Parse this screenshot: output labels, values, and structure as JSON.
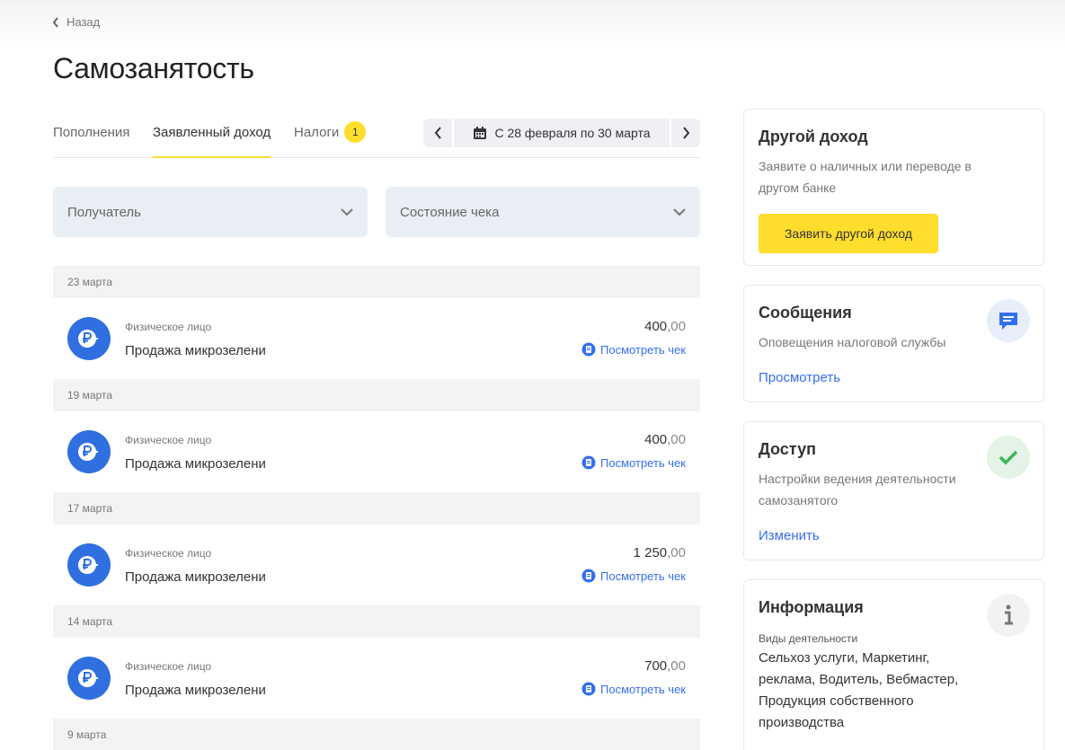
{
  "nav": {
    "back_label": "Назад"
  },
  "page": {
    "title": "Самозанятость"
  },
  "tabs": [
    {
      "label": "Пополнения",
      "active": false
    },
    {
      "label": "Заявленный доход",
      "active": true
    },
    {
      "label": "Налоги",
      "active": false,
      "badge": "1"
    }
  ],
  "period": {
    "label": "С 28 февраля по 30 марта"
  },
  "filters": {
    "recipient": "Получатель",
    "receipt_state": "Состояние чека"
  },
  "operations": [
    {
      "date": "23 марта",
      "counterparty": "Физическое лицо",
      "title": "Продажа микрозелени",
      "amount_int": "400",
      "amount_dec": ",00",
      "check_label": "Посмотреть чек"
    },
    {
      "date": "19 марта",
      "counterparty": "Физическое лицо",
      "title": "Продажа микрозелени",
      "amount_int": "400",
      "amount_dec": ",00",
      "check_label": "Посмотреть чек"
    },
    {
      "date": "17 марта",
      "counterparty": "Физическое лицо",
      "title": "Продажа микрозелени",
      "amount_int": "1 250",
      "amount_dec": ",00",
      "check_label": "Посмотреть чек"
    },
    {
      "date": "14 марта",
      "counterparty": "Физическое лицо",
      "title": "Продажа микрозелени",
      "amount_int": "700",
      "amount_dec": ",00",
      "check_label": "Посмотреть чек"
    }
  ],
  "last_date_header": "9 марта",
  "cards": {
    "other_income": {
      "title": "Другой доход",
      "text": "Заявите о наличных или переводе в другом банке",
      "button": "Заявить другой доход"
    },
    "messages": {
      "title": "Сообщения",
      "text": "Оповещения налоговой службы",
      "link": "Просмотреть",
      "icon": "message-icon"
    },
    "access": {
      "title": "Доступ",
      "text": "Настройки ведения деятельности самозанятого",
      "link": "Изменить",
      "icon": "check-icon"
    },
    "info": {
      "title": "Информация",
      "label": "Виды деятельности",
      "value": "Сельхоз услуги, Маркетинг, реклама, Водитель, Вебмастер, Продукция собственного производства",
      "icon": "info-icon"
    }
  },
  "colors": {
    "accent_yellow": "#ffdd2d",
    "link_blue": "#336fee",
    "operation_icon": "#2f6fe0",
    "filter_bg": "#e9edf4"
  }
}
